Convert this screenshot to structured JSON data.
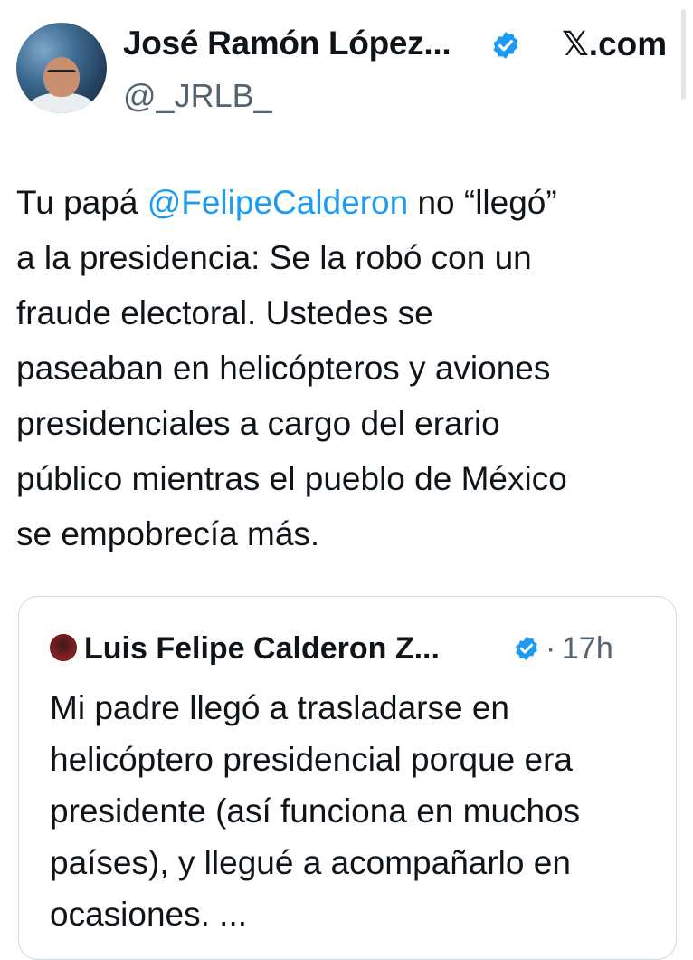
{
  "author": {
    "display_name": "José Ramón López...",
    "handle": "@_JRLB_",
    "verified_icon": "verified-badge-icon"
  },
  "site": {
    "label": "𝕏.com"
  },
  "tweet": {
    "line_1_before": "Tu papá ",
    "mention": "@FelipeCalderon",
    "line_1_after": " no “llegó”",
    "lines": [
      "a la presidencia: Se la robó con un",
      "fraude electoral. Ustedes se",
      "paseaban en helicópteros y aviones",
      "presidenciales a cargo del erario",
      "público mientras el pueblo de México",
      "se empobrecía más."
    ]
  },
  "quoted_tweet": {
    "display_name": "Luis Felipe Calderon Z...",
    "separator": "·",
    "time": "17h",
    "verified_icon": "verified-badge-icon",
    "lines": [
      "Mi padre llegó a trasladarse en",
      "helicóptero presidencial porque era",
      "presidente (así funciona en muchos",
      "países), y llegué a acompañarlo en",
      "ocasiones. ..."
    ]
  },
  "colors": {
    "text": "#0f1419",
    "secondary": "#536471",
    "link": "#1d9bf0",
    "verified": "#1d9bf0",
    "border": "#cfd9de"
  }
}
